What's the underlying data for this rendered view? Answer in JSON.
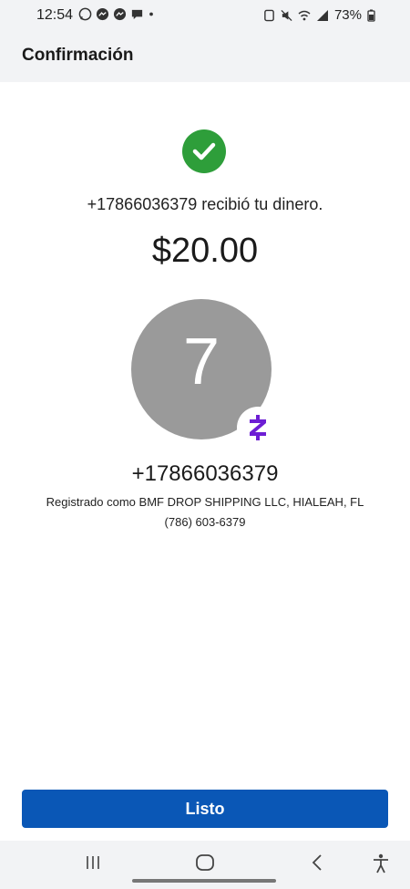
{
  "status_bar": {
    "time": "12:54",
    "battery": "73%",
    "left_icons": [
      "whatsapp-icon",
      "messenger-icon",
      "messenger-icon",
      "chat-icon",
      "dot-icon"
    ],
    "right_icons": [
      "nfc-icon",
      "mute-icon",
      "wifi-icon",
      "signal-icon",
      "battery-icon"
    ]
  },
  "header": {
    "title": "Confirmación"
  },
  "confirmation": {
    "status_icon": "check-circle-icon",
    "message": "+17866036379 recibió tu dinero.",
    "amount": "$20.00",
    "colors": {
      "success": "#2e9e3a",
      "avatar_bg": "#9a9a9a",
      "zelle": "#6d1ed4",
      "button": "#0a57b6"
    }
  },
  "recipient": {
    "avatar_letter": "7",
    "badge_icon": "zelle-icon",
    "phone": "+17866036379",
    "registered_as": "Registrado como BMF DROP SHIPPING LLC, HIALEAH, FL",
    "contact_phone": "(786) 603-6379"
  },
  "actions": {
    "done_label": "Listo"
  },
  "nav_bar": {
    "items": [
      "recents-icon",
      "home-icon",
      "back-icon",
      "accessibility-icon"
    ]
  }
}
